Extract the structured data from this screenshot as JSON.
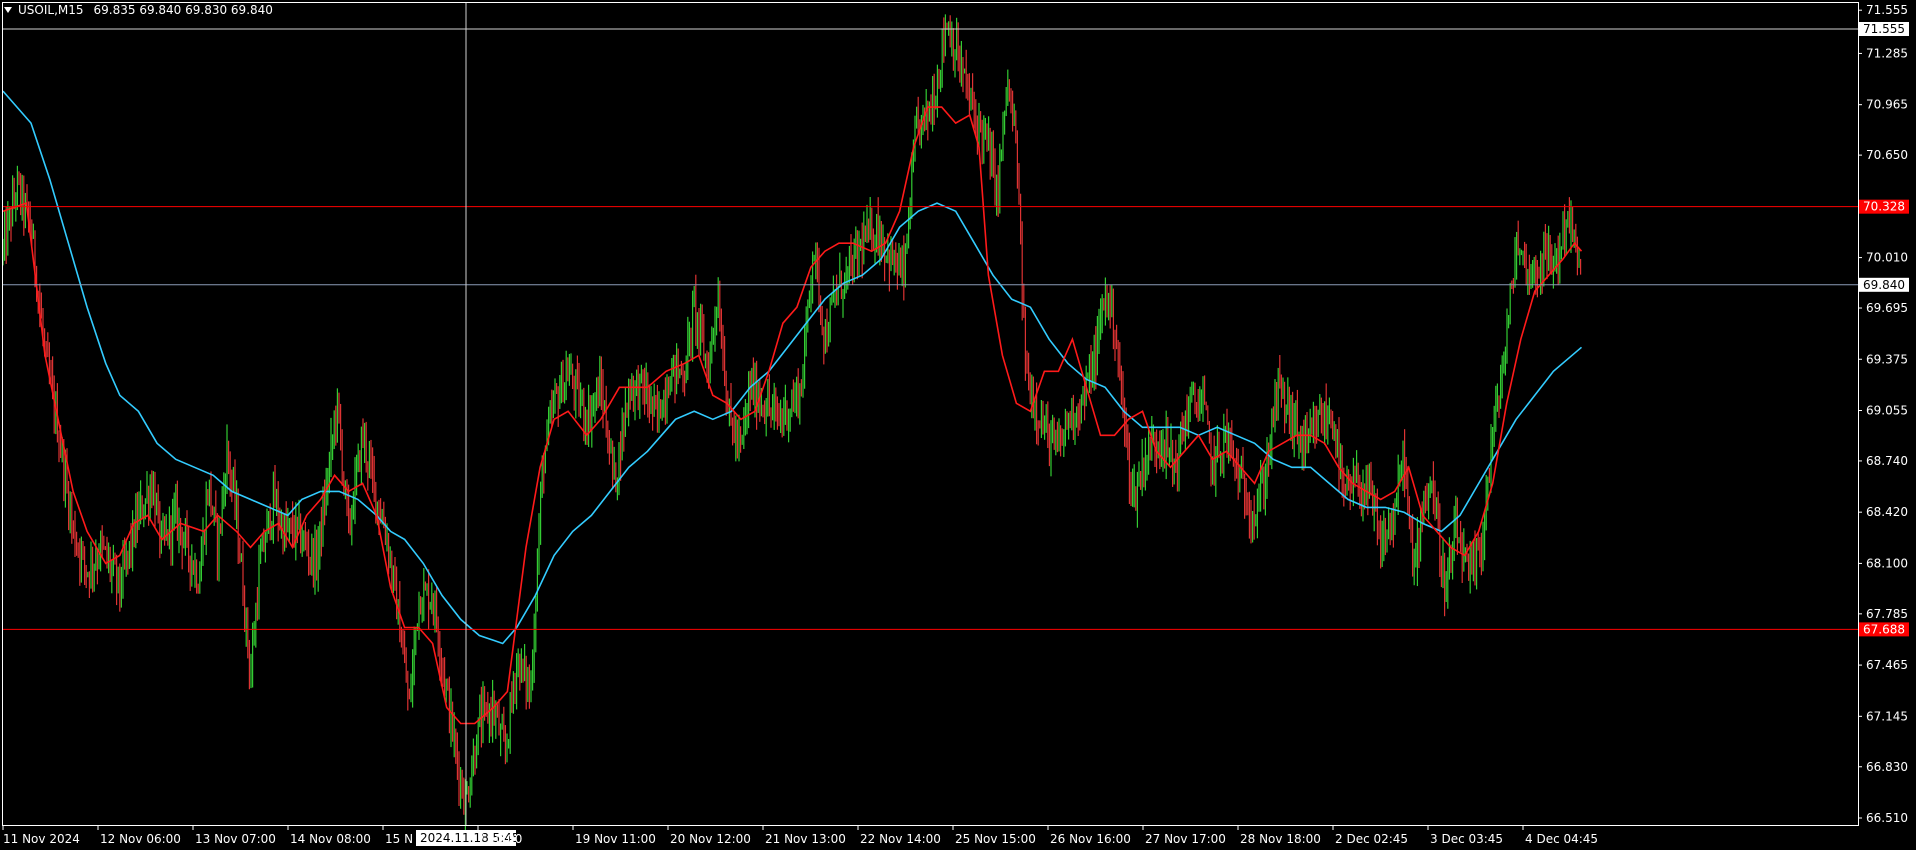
{
  "window": {
    "symbol_label": "USOIL,M15",
    "ohlc_label": "69.835 69.840 69.830 69.840"
  },
  "colors": {
    "background": "#000000",
    "frame": "#ffffff",
    "bull_candle": "#33cc33",
    "bear_candle": "#dd3333",
    "ma_fast": "#ff1a1a",
    "ma_slow": "#33ccff",
    "level_line": "#ff0000",
    "current_price_line": "#8c9cb8",
    "crosshair": "#d0d0d0"
  },
  "crosshair": {
    "time_label": "2024.11.18 5:45",
    "price_label": "71.555"
  },
  "chart_data": {
    "type": "candlestick",
    "symbol": "USOIL",
    "timeframe": "M15",
    "y_ticks": [
      "71.555",
      "71.285",
      "70.965",
      "70.650",
      "70.010",
      "69.695",
      "69.375",
      "69.055",
      "68.740",
      "68.420",
      "68.100",
      "67.785",
      "67.465",
      "67.145",
      "66.830",
      "66.510"
    ],
    "x_ticks": [
      "11 Nov 2024",
      "12 Nov 06:00",
      "13 Nov 07:00",
      "14 Nov 08:00",
      "15 N",
      "/ 10:00",
      "19 Nov 11:00",
      "20 Nov 12:00",
      "21 Nov 13:00",
      "22 Nov 14:00",
      "25 Nov 15:00",
      "26 Nov 16:00",
      "27 Nov 17:00",
      "28 Nov 18:00",
      "2 Dec 02:45",
      "3 Dec 03:45",
      "4 Dec 04:45"
    ],
    "price_range": [
      66.46,
      71.6
    ],
    "horizontal_levels": [
      {
        "price": 70.328,
        "label": "70.328",
        "kind": "resistance"
      },
      {
        "price": 67.688,
        "label": "67.688",
        "kind": "support"
      }
    ],
    "current_price": {
      "price": 69.84,
      "label": "69.840"
    },
    "price_path": [
      [
        0,
        70.05
      ],
      [
        0.6,
        70.45
      ],
      [
        1.2,
        70.2
      ],
      [
        1.8,
        69.4
      ],
      [
        2.4,
        68.9
      ],
      [
        3,
        68.3
      ],
      [
        3.6,
        68.05
      ],
      [
        4.2,
        68.2
      ],
      [
        5,
        67.95
      ],
      [
        5.8,
        68.4
      ],
      [
        6.4,
        68.6
      ],
      [
        6.8,
        68.2
      ],
      [
        7.4,
        68.4
      ],
      [
        8,
        68.15
      ],
      [
        8.4,
        68.0
      ],
      [
        8.8,
        68.6
      ],
      [
        9.2,
        68.2
      ],
      [
        9.6,
        68.8
      ],
      [
        10,
        68.4
      ],
      [
        10.6,
        67.4
      ],
      [
        11,
        68.1
      ],
      [
        11.6,
        68.5
      ],
      [
        12,
        68.3
      ],
      [
        12.6,
        68.3
      ],
      [
        13.4,
        68.1
      ],
      [
        13.8,
        68.5
      ],
      [
        14.3,
        69.1
      ],
      [
        14.8,
        68.3
      ],
      [
        15.4,
        68.9
      ],
      [
        16,
        68.5
      ],
      [
        16.4,
        68.3
      ],
      [
        17,
        67.7
      ],
      [
        17.4,
        67.2
      ],
      [
        17.8,
        67.9
      ],
      [
        18.4,
        67.9
      ],
      [
        18.8,
        67.5
      ],
      [
        19.4,
        66.9
      ],
      [
        19.8,
        66.6
      ],
      [
        20.4,
        67.1
      ],
      [
        21,
        67.2
      ],
      [
        21.5,
        66.9
      ],
      [
        22,
        67.5
      ],
      [
        22.6,
        67.3
      ],
      [
        23.1,
        68.7
      ],
      [
        23.6,
        69.1
      ],
      [
        24.2,
        69.3
      ],
      [
        25,
        69.0
      ],
      [
        25.6,
        69.2
      ],
      [
        26.2,
        68.6
      ],
      [
        26.8,
        69.2
      ],
      [
        27.4,
        69.2
      ],
      [
        28,
        69.0
      ],
      [
        28.6,
        69.3
      ],
      [
        29.2,
        69.3
      ],
      [
        29.6,
        69.7
      ],
      [
        30.2,
        69.3
      ],
      [
        30.6,
        69.8
      ],
      [
        31.1,
        69.0
      ],
      [
        31.6,
        68.8
      ],
      [
        32,
        69.2
      ],
      [
        32.6,
        69.1
      ],
      [
        33.2,
        69.0
      ],
      [
        33.8,
        69.1
      ],
      [
        34.2,
        69.2
      ],
      [
        34.7,
        70.1
      ],
      [
        35.2,
        69.5
      ],
      [
        35.7,
        69.8
      ],
      [
        36.2,
        69.9
      ],
      [
        36.8,
        70.1
      ],
      [
        37.4,
        70.2
      ],
      [
        38,
        70.0
      ],
      [
        38.6,
        69.9
      ],
      [
        39.1,
        70.8
      ],
      [
        39.6,
        70.9
      ],
      [
        40,
        71.1
      ],
      [
        40.4,
        71.5
      ],
      [
        41,
        71.2
      ],
      [
        41.6,
        70.9
      ],
      [
        42.2,
        70.7
      ],
      [
        42.6,
        70.4
      ],
      [
        43,
        71.1
      ],
      [
        43.4,
        70.7
      ],
      [
        43.8,
        69.3
      ],
      [
        44.2,
        69.1
      ],
      [
        44.7,
        68.9
      ],
      [
        45.2,
        68.8
      ],
      [
        45.6,
        69.0
      ],
      [
        46.2,
        69.1
      ],
      [
        46.8,
        69.4
      ],
      [
        47.2,
        69.8
      ],
      [
        47.6,
        69.6
      ],
      [
        48,
        69.0
      ],
      [
        48.4,
        68.5
      ],
      [
        49,
        68.8
      ],
      [
        49.6,
        68.9
      ],
      [
        50.2,
        68.7
      ],
      [
        50.8,
        69.1
      ],
      [
        51.4,
        69.1
      ],
      [
        51.8,
        68.7
      ],
      [
        52.4,
        68.9
      ],
      [
        53,
        68.6
      ],
      [
        53.6,
        68.4
      ],
      [
        54,
        68.6
      ],
      [
        54.6,
        69.2
      ],
      [
        55.2,
        69.0
      ],
      [
        55.8,
        68.8
      ],
      [
        56.4,
        69.0
      ],
      [
        57,
        69.0
      ],
      [
        57.4,
        68.5
      ],
      [
        58,
        68.6
      ],
      [
        58.6,
        68.5
      ],
      [
        59,
        68.2
      ],
      [
        59.6,
        68.4
      ],
      [
        60,
        68.8
      ],
      [
        60.4,
        68.0
      ],
      [
        60.8,
        68.5
      ],
      [
        61.2,
        68.6
      ],
      [
        61.8,
        67.9
      ],
      [
        62.2,
        68.3
      ],
      [
        62.8,
        68.0
      ],
      [
        63.3,
        68.2
      ],
      [
        63.8,
        68.9
      ],
      [
        64.4,
        69.5
      ],
      [
        64.8,
        70.1
      ],
      [
        65.4,
        69.9
      ],
      [
        66,
        70.0
      ],
      [
        66.6,
        70.0
      ],
      [
        67,
        70.3
      ],
      [
        67.3,
        70.1
      ],
      [
        67.6,
        69.84
      ]
    ],
    "ma_fast": [
      [
        0,
        70.3
      ],
      [
        1,
        70.35
      ],
      [
        1.8,
        69.4
      ],
      [
        2.5,
        68.9
      ],
      [
        3,
        68.55
      ],
      [
        3.6,
        68.3
      ],
      [
        4.4,
        68.1
      ],
      [
        5,
        68.15
      ],
      [
        5.6,
        68.35
      ],
      [
        6.2,
        68.4
      ],
      [
        6.8,
        68.25
      ],
      [
        7.6,
        68.35
      ],
      [
        8.6,
        68.3
      ],
      [
        9.2,
        68.4
      ],
      [
        10,
        68.3
      ],
      [
        10.6,
        68.2
      ],
      [
        11.2,
        68.3
      ],
      [
        11.8,
        68.35
      ],
      [
        12.4,
        68.2
      ],
      [
        13,
        68.4
      ],
      [
        13.6,
        68.5
      ],
      [
        14.2,
        68.65
      ],
      [
        14.8,
        68.55
      ],
      [
        15.4,
        68.6
      ],
      [
        16,
        68.4
      ],
      [
        16.6,
        67.95
      ],
      [
        17.2,
        67.7
      ],
      [
        17.8,
        67.7
      ],
      [
        18.4,
        67.6
      ],
      [
        19,
        67.2
      ],
      [
        19.6,
        67.1
      ],
      [
        20.2,
        67.1
      ],
      [
        21,
        67.2
      ],
      [
        21.6,
        67.3
      ],
      [
        22.4,
        68.2
      ],
      [
        23,
        68.7
      ],
      [
        23.6,
        69.0
      ],
      [
        24.2,
        69.05
      ],
      [
        25,
        68.9
      ],
      [
        25.6,
        69.0
      ],
      [
        26.4,
        69.2
      ],
      [
        27,
        69.2
      ],
      [
        27.6,
        69.2
      ],
      [
        28.4,
        69.3
      ],
      [
        29.2,
        69.35
      ],
      [
        29.8,
        69.4
      ],
      [
        30.4,
        69.15
      ],
      [
        31,
        69.1
      ],
      [
        31.6,
        69.0
      ],
      [
        32.2,
        69.05
      ],
      [
        32.8,
        69.3
      ],
      [
        33.4,
        69.6
      ],
      [
        34,
        69.7
      ],
      [
        34.6,
        69.95
      ],
      [
        35.2,
        70.05
      ],
      [
        35.8,
        70.1
      ],
      [
        36.4,
        70.1
      ],
      [
        37.2,
        70.05
      ],
      [
        37.8,
        70.1
      ],
      [
        38.4,
        70.3
      ],
      [
        39,
        70.7
      ],
      [
        39.6,
        70.95
      ],
      [
        40.2,
        70.95
      ],
      [
        40.8,
        70.85
      ],
      [
        41.4,
        70.9
      ],
      [
        41.8,
        70.7
      ],
      [
        42.2,
        69.9
      ],
      [
        42.8,
        69.4
      ],
      [
        43.4,
        69.1
      ],
      [
        44,
        69.05
      ],
      [
        44.6,
        69.3
      ],
      [
        45.2,
        69.3
      ],
      [
        45.8,
        69.5
      ],
      [
        46.4,
        69.2
      ],
      [
        47,
        68.9
      ],
      [
        47.6,
        68.9
      ],
      [
        48.2,
        69.0
      ],
      [
        48.8,
        69.05
      ],
      [
        49.4,
        68.8
      ],
      [
        50,
        68.7
      ],
      [
        50.6,
        68.8
      ],
      [
        51.2,
        68.9
      ],
      [
        51.8,
        68.75
      ],
      [
        52.4,
        68.8
      ],
      [
        53,
        68.7
      ],
      [
        53.6,
        68.6
      ],
      [
        54.2,
        68.8
      ],
      [
        54.8,
        68.85
      ],
      [
        55.4,
        68.9
      ],
      [
        56,
        68.9
      ],
      [
        56.6,
        68.85
      ],
      [
        57.2,
        68.7
      ],
      [
        57.8,
        68.6
      ],
      [
        58.4,
        68.55
      ],
      [
        59,
        68.5
      ],
      [
        59.6,
        68.55
      ],
      [
        60.2,
        68.7
      ],
      [
        60.8,
        68.4
      ],
      [
        61.4,
        68.3
      ],
      [
        62,
        68.2
      ],
      [
        62.6,
        68.15
      ],
      [
        63.2,
        68.3
      ],
      [
        63.8,
        68.6
      ],
      [
        64.4,
        69.1
      ],
      [
        65,
        69.5
      ],
      [
        65.6,
        69.8
      ],
      [
        66.2,
        69.9
      ],
      [
        66.8,
        70.0
      ],
      [
        67.3,
        70.1
      ],
      [
        67.6,
        70.05
      ]
    ],
    "ma_slow": [
      [
        0,
        71.05
      ],
      [
        0.6,
        70.95
      ],
      [
        1.2,
        70.85
      ],
      [
        2,
        70.5
      ],
      [
        2.8,
        70.1
      ],
      [
        3.6,
        69.7
      ],
      [
        4.4,
        69.35
      ],
      [
        5,
        69.15
      ],
      [
        5.8,
        69.05
      ],
      [
        6.6,
        68.85
      ],
      [
        7.4,
        68.75
      ],
      [
        8.2,
        68.7
      ],
      [
        9,
        68.65
      ],
      [
        9.8,
        68.55
      ],
      [
        10.6,
        68.5
      ],
      [
        11.4,
        68.45
      ],
      [
        12.2,
        68.4
      ],
      [
        12.8,
        68.5
      ],
      [
        13.6,
        68.55
      ],
      [
        14.4,
        68.55
      ],
      [
        15.2,
        68.5
      ],
      [
        16,
        68.4
      ],
      [
        16.6,
        68.3
      ],
      [
        17.2,
        68.25
      ],
      [
        18,
        68.1
      ],
      [
        18.8,
        67.9
      ],
      [
        19.6,
        67.75
      ],
      [
        20.4,
        67.65
      ],
      [
        21,
        67.62
      ],
      [
        21.4,
        67.6
      ],
      [
        22,
        67.7
      ],
      [
        22.8,
        67.9
      ],
      [
        23.6,
        68.15
      ],
      [
        24.4,
        68.3
      ],
      [
        25.2,
        68.4
      ],
      [
        26,
        68.55
      ],
      [
        26.8,
        68.7
      ],
      [
        27.6,
        68.8
      ],
      [
        28.2,
        68.9
      ],
      [
        28.8,
        69.0
      ],
      [
        29.6,
        69.05
      ],
      [
        30.4,
        69.0
      ],
      [
        31.2,
        69.05
      ],
      [
        32,
        69.2
      ],
      [
        32.8,
        69.3
      ],
      [
        33.6,
        69.45
      ],
      [
        34.4,
        69.6
      ],
      [
        35.2,
        69.75
      ],
      [
        36,
        69.85
      ],
      [
        36.8,
        69.9
      ],
      [
        37.6,
        70.0
      ],
      [
        38.4,
        70.2
      ],
      [
        39.2,
        70.3
      ],
      [
        40,
        70.35
      ],
      [
        40.8,
        70.3
      ],
      [
        41.6,
        70.1
      ],
      [
        42.4,
        69.9
      ],
      [
        43.2,
        69.75
      ],
      [
        44,
        69.7
      ],
      [
        44.8,
        69.5
      ],
      [
        45.6,
        69.35
      ],
      [
        46.4,
        69.25
      ],
      [
        47.2,
        69.2
      ],
      [
        48,
        69.05
      ],
      [
        48.8,
        68.95
      ],
      [
        49.6,
        68.95
      ],
      [
        50.4,
        68.95
      ],
      [
        51.2,
        68.9
      ],
      [
        52,
        68.95
      ],
      [
        52.8,
        68.9
      ],
      [
        53.6,
        68.85
      ],
      [
        54.4,
        68.75
      ],
      [
        55.2,
        68.7
      ],
      [
        56,
        68.7
      ],
      [
        56.8,
        68.6
      ],
      [
        57.6,
        68.5
      ],
      [
        58.4,
        68.45
      ],
      [
        59.2,
        68.45
      ],
      [
        60,
        68.42
      ],
      [
        60.8,
        68.35
      ],
      [
        61.6,
        68.3
      ],
      [
        62.4,
        68.4
      ],
      [
        63.2,
        68.6
      ],
      [
        64,
        68.8
      ],
      [
        64.8,
        69.0
      ],
      [
        65.6,
        69.15
      ],
      [
        66.4,
        69.3
      ],
      [
        67.2,
        69.4
      ],
      [
        67.6,
        69.45
      ]
    ]
  }
}
